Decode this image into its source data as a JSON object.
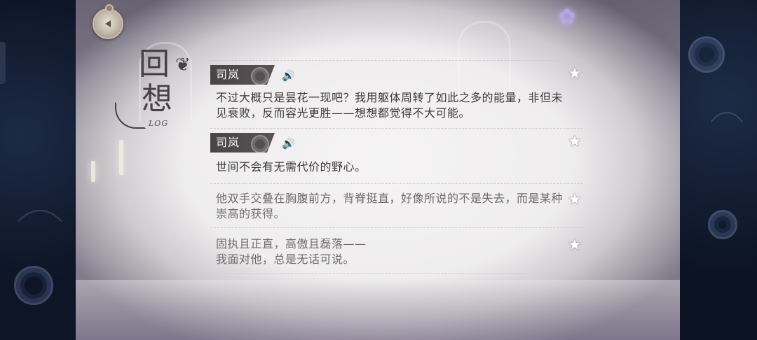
{
  "header": {
    "title_char_1": "回",
    "title_char_2": "想",
    "title_sub": "LOG",
    "compass_icon": "compass-icon",
    "flower_icon": "flower-icon"
  },
  "entries": [
    {
      "speaker": "司岚",
      "text": "不过大概只是昙花一现吧？我用躯体周转了如此之多的能量，非但未见衰败，反而容光更胜——想想都觉得不大可能。",
      "type": "dialogue"
    },
    {
      "speaker": "司岚",
      "text": "世间不会有无需代价的野心。",
      "type": "dialogue"
    },
    {
      "speaker": "",
      "text": "他双手交叠在胸腹前方，背脊挺直，好像所说的不是失去，而是某种崇高的获得。",
      "type": "narration"
    },
    {
      "speaker": "",
      "text": "固执且正直，高傲且磊落——\n我面对他，总是无话可说。",
      "type": "narration"
    }
  ],
  "icons": {
    "voice": "speaker-icon",
    "favorite": "star-icon",
    "title_decoration": "butterfly-icon"
  },
  "colors": {
    "tag_bg": "#4a4446",
    "text_main": "#3c3839",
    "text_narration": "#6f6a6b"
  }
}
